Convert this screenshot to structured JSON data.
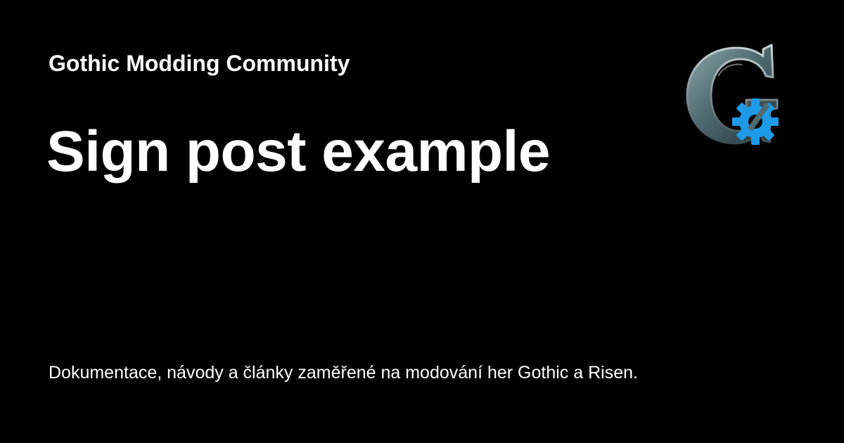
{
  "site": {
    "name": "Gothic Modding Community"
  },
  "page": {
    "title": "Sign post example",
    "description": "Dokumentace, návody a články zaměřené na modování her Gothic a Risen."
  },
  "logo": {
    "icon": "gothic-g-gear-logo-icon",
    "letter": "G",
    "letter_color": "#5b7a80",
    "gear_color": "#1e9be8"
  },
  "colors": {
    "background": "#000000",
    "text": "#ffffff"
  }
}
